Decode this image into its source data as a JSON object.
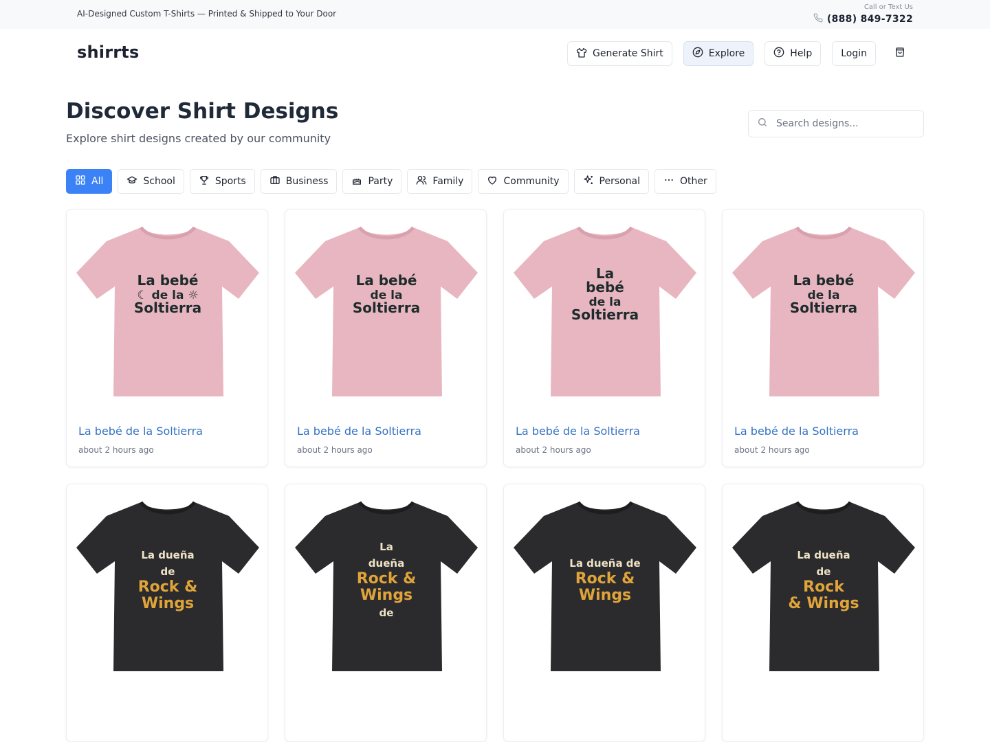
{
  "topbar": {
    "tagline": "AI-Designed Custom T-Shirts — Printed & Shipped to Your Door",
    "call_label": "Call or Text Us",
    "phone": "(888) 849-7322"
  },
  "header": {
    "logo": "shirrts",
    "nav": [
      {
        "label": "Generate Shirt",
        "icon": "shirt-icon"
      },
      {
        "label": "Explore",
        "icon": "compass-icon",
        "active": true
      },
      {
        "label": "Help",
        "icon": "help-circle-icon"
      },
      {
        "label": "Login"
      }
    ],
    "cart_icon": "shopping-bag-icon"
  },
  "page": {
    "title": "Discover Shirt Designs",
    "subtitle": "Explore shirt designs created by our community",
    "search_placeholder": "Search designs..."
  },
  "filters": [
    {
      "label": "All",
      "icon": "grid-icon",
      "active": true
    },
    {
      "label": "School",
      "icon": "graduation-cap-icon"
    },
    {
      "label": "Sports",
      "icon": "trophy-icon"
    },
    {
      "label": "Business",
      "icon": "briefcase-icon"
    },
    {
      "label": "Party",
      "icon": "cake-icon"
    },
    {
      "label": "Family",
      "icon": "users-icon"
    },
    {
      "label": "Community",
      "icon": "heart-icon"
    },
    {
      "label": "Personal",
      "icon": "sparkles-icon"
    },
    {
      "label": "Other",
      "icon": "more-dots-icon"
    }
  ],
  "colors": {
    "accent": "#3b82f6",
    "link": "#3272c4",
    "shirt_pink": "#e8b6c0",
    "shirt_black": "#2b2b2d",
    "print_dark": "#1d2b2c",
    "print_gold": "#e0a43a",
    "print_cream": "#efe3c6"
  },
  "designs": [
    {
      "title": "La bebé de la Soltierra",
      "time": "about 2 hours ago",
      "shirt": "pink",
      "print_lines": [
        "La bebé",
        "☾ de la ☼",
        "Soltierra"
      ]
    },
    {
      "title": "La bebé de la Soltierra",
      "time": "about 2 hours ago",
      "shirt": "pink",
      "print_lines": [
        "La bebé",
        "de la",
        "Soltierra"
      ]
    },
    {
      "title": "La bebé de la Soltierra",
      "time": "about 2 hours ago",
      "shirt": "pink",
      "print_lines": [
        "La",
        "bebé",
        "de la",
        "Soltierra"
      ]
    },
    {
      "title": "La bebé de la Soltierra",
      "time": "about 2 hours ago",
      "shirt": "pink",
      "print_lines": [
        "La bebé",
        "de la",
        "Soltierra"
      ]
    },
    {
      "shirt": "black",
      "print_lines": [
        "La dueña",
        "de",
        "Rock &",
        "Wings"
      ]
    },
    {
      "shirt": "black",
      "print_lines": [
        "La",
        "dueña",
        "Rock &",
        "Wings",
        "de"
      ]
    },
    {
      "shirt": "black",
      "print_lines": [
        "La dueña de",
        "Rock &",
        "Wings"
      ]
    },
    {
      "shirt": "black",
      "print_lines": [
        "La dueña",
        "de",
        "Rock",
        "& Wings"
      ]
    }
  ]
}
